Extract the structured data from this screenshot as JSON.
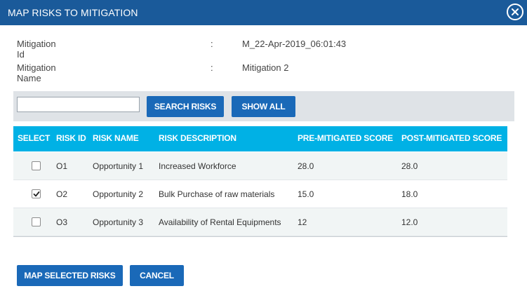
{
  "dialog": {
    "title": "MAP RISKS TO MITIGATION",
    "close_icon": "close-circle-icon"
  },
  "mitigation": {
    "id_label": "Mitigation Id",
    "id_value": "M_22-Apr-2019_06:01:43",
    "name_label": "Mitigation Name",
    "name_value": "Mitigation 2",
    "separator": ":"
  },
  "search": {
    "value": "",
    "placeholder": "",
    "search_button_label": "SEARCH RISKS",
    "show_all_button_label": "SHOW ALL"
  },
  "table": {
    "headers": {
      "select": "SELECT",
      "risk_id": "RISK ID",
      "risk_name": "RISK NAME",
      "risk_description": "RISK DESCRIPTION",
      "pre_mitigated_score": "PRE-MITIGATED SCORE",
      "post_mitigated_score": "POST-MITIGATED SCORE"
    },
    "rows": [
      {
        "selected": false,
        "risk_id": "O1",
        "risk_name": "Opportunity 1",
        "risk_description": "Increased Workforce",
        "pre_mitigated_score": "28.0",
        "post_mitigated_score": "28.0"
      },
      {
        "selected": true,
        "risk_id": "O2",
        "risk_name": "Opportunity 2",
        "risk_description": "Bulk Purchase of raw materials",
        "pre_mitigated_score": "15.0",
        "post_mitigated_score": "18.0"
      },
      {
        "selected": false,
        "risk_id": "O3",
        "risk_name": "Opportunity 3",
        "risk_description": "Availability of Rental Equipments",
        "pre_mitigated_score": "12",
        "post_mitigated_score": "12.0"
      }
    ]
  },
  "footer": {
    "map_button_label": "MAP SELECTED RISKS",
    "cancel_button_label": "CANCEL"
  },
  "colors": {
    "titlebar": "#1a5a9a",
    "header": "#00b1e5",
    "button": "#1a69b8"
  }
}
